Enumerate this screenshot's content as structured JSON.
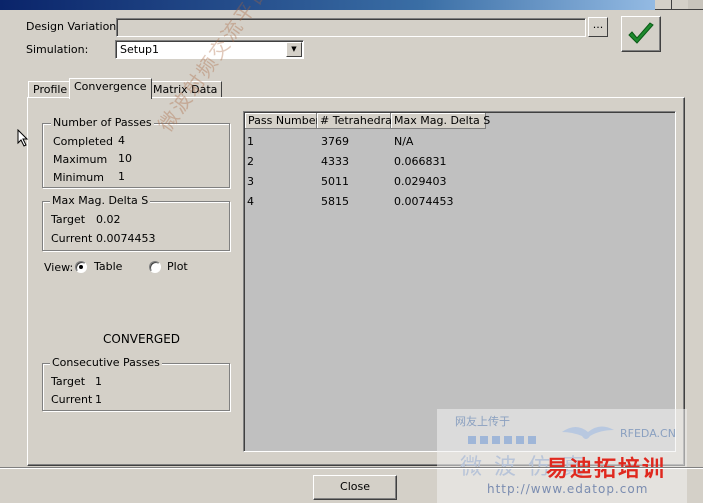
{
  "window": {
    "title_visible": ""
  },
  "design_variation": {
    "label": "Design Variation:",
    "value": "",
    "browse_label": "..."
  },
  "simulation": {
    "label": "Simulation:",
    "selected": "Setup1"
  },
  "tabs": [
    {
      "label": "Profile"
    },
    {
      "label": "Convergence"
    },
    {
      "label": "Matrix Data"
    }
  ],
  "number_of_passes": {
    "title": "Number of Passes",
    "completed_label": "Completed",
    "completed_value": "4",
    "maximum_label": "Maximum",
    "maximum_value": "10",
    "minimum_label": "Minimum",
    "minimum_value": "1"
  },
  "max_mag_delta_s": {
    "title": "Max Mag. Delta S",
    "target_label": "Target",
    "target_value": "0.02",
    "current_label": "Current",
    "current_value": "0.0074453"
  },
  "view": {
    "label": "View:",
    "options": [
      "Table",
      "Plot"
    ],
    "selected": "Table"
  },
  "status_text": "CONVERGED",
  "consecutive_passes": {
    "title": "Consecutive Passes",
    "target_label": "Target",
    "target_value": "1",
    "current_label": "Current",
    "current_value": "1"
  },
  "table": {
    "columns": [
      "Pass Number",
      "# Tetrahedra",
      "Max Mag. Delta S"
    ],
    "rows": [
      [
        "1",
        "3769",
        "N/A"
      ],
      [
        "2",
        "4333",
        "0.066831"
      ],
      [
        "3",
        "5011",
        "0.029403"
      ],
      [
        "4",
        "5815",
        "0.0074453"
      ]
    ]
  },
  "buttons": {
    "close_label": "Close"
  },
  "watermark": {
    "line1": "网友上传于",
    "brand_small": "RFEDA.CN",
    "cn_brand": "微波仿真",
    "cn_training": "易迪拓培训",
    "url": "http://www.edatop.com",
    "diag_text": "微波射频交流平台"
  },
  "colors": {
    "ok_check": "#1e8a2e",
    "title_bar": "#0a246a",
    "watermark_red": "#e0281e"
  },
  "icons": [
    "check-icon",
    "dropdown-arrow-icon",
    "mouse-cursor-icon"
  ]
}
